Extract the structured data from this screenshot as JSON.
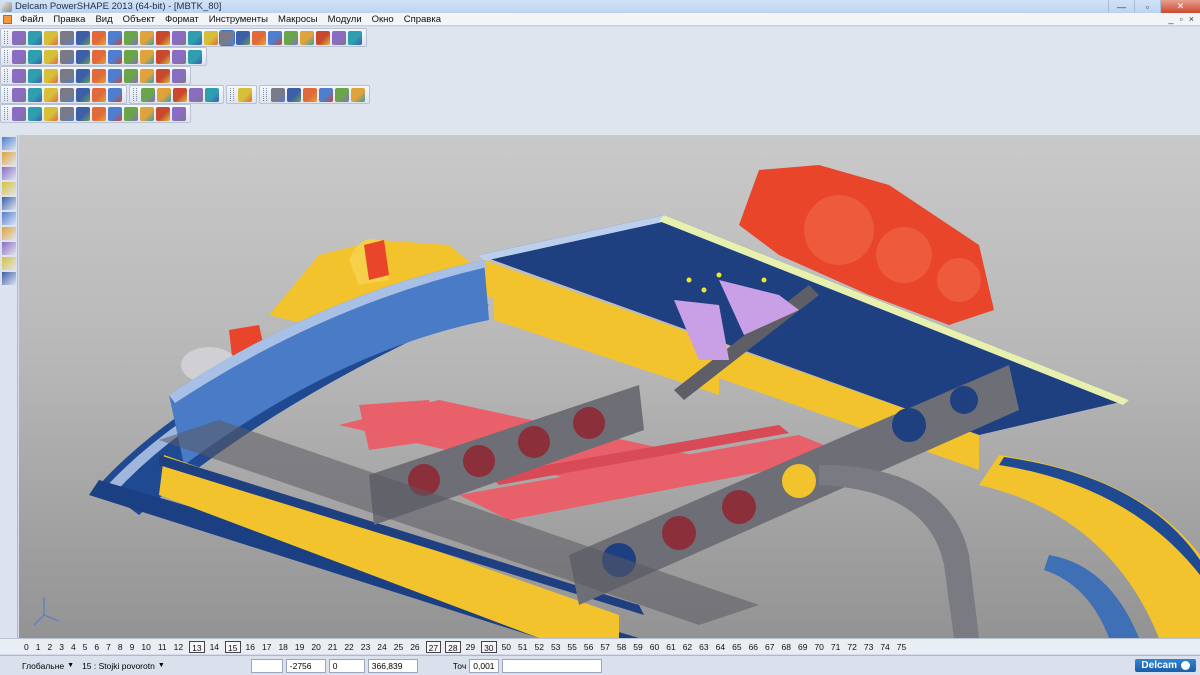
{
  "window": {
    "title": "Delcam PowerSHAPE 2013 (64-bit) - [MBTK_80]",
    "minimize": "—",
    "maximize": "▫",
    "close": "✕"
  },
  "menu": {
    "items": [
      "Файл",
      "Правка",
      "Вид",
      "Объект",
      "Формат",
      "Инструменты",
      "Макросы",
      "Модули",
      "Окно",
      "Справка"
    ],
    "mdi_minimize": "_",
    "mdi_restore": "▫",
    "mdi_close": "×"
  },
  "toolbars": {
    "row1_icons": [
      "new-model-icon",
      "open-icon",
      "save-icon",
      "save-as-icon",
      "print-icon",
      "cut-icon",
      "copy-icon",
      "paste-icon",
      "delete-icon",
      "undo-icon",
      "redo-icon",
      "snap-icon",
      "rotate-view-icon",
      "select-icon",
      "circle-icon",
      "spline-icon",
      "curve-icon",
      "surface-icon",
      "solid-icon",
      "lamp-icon",
      "sketch-icon",
      "hammer-icon"
    ],
    "row2_icons": [
      "view-box-icon",
      "view-iso-icon",
      "view-front-icon",
      "view-cube-icon",
      "view-flip-icon",
      "zoom-icon",
      "zoom-fit-icon",
      "globe-icon",
      "shade-icon",
      "wire-icon",
      "light-icon",
      "render-icon"
    ],
    "row3_icons": [
      "doc-icon",
      "sphere-icon",
      "cone-icon",
      "torus-icon",
      "cylinder-icon",
      "play-icon",
      "play2-icon",
      "block-icon",
      "cube-icon",
      "boolean-icon",
      "fillet-icon"
    ],
    "row4_icons": [
      "solid-a-icon",
      "solid-b-icon",
      "solid-c-icon",
      "solid-d-icon",
      "solid-e-icon",
      "solid-f-icon",
      "solid-g-icon",
      "feature-a-icon",
      "feature-b-icon",
      "feature-c-icon",
      "feature-d-icon",
      "feature-e-icon",
      "tree-a-icon",
      "tree-b-icon",
      "tree-c-icon",
      "tree-d-icon",
      "tree-e-icon",
      "tree-f-icon",
      "tree-g-icon"
    ],
    "row5_icons": [
      "surface-a-icon",
      "curve-x-icon",
      "surface-b-icon",
      "surface-c-icon",
      "surface-d-icon",
      "surface-e-icon",
      "surface-f-icon",
      "surface-g-icon",
      "surface-h-icon",
      "surface-i-icon",
      "surface-j-icon"
    ]
  },
  "left_tools": [
    "select-tool-icon",
    "selection-filter-icon",
    "line-tool-icon",
    "spline-tool-icon",
    "rectangle-tool-icon",
    "circle-tool-icon",
    "solid-tool-icon",
    "dimension-tool-icon",
    "arc-tool-icon",
    "angle-tool-icon"
  ],
  "levels": {
    "items": [
      "0",
      "1",
      "2",
      "3",
      "4",
      "5",
      "6",
      "7",
      "8",
      "9",
      "10",
      "11",
      "12",
      "13",
      "14",
      "15",
      "16",
      "17",
      "18",
      "19",
      "20",
      "21",
      "22",
      "23",
      "24",
      "25",
      "26",
      "27",
      "28",
      "29",
      "30",
      "50",
      "51",
      "52",
      "53",
      "55",
      "56",
      "57",
      "58",
      "59",
      "60",
      "61",
      "62",
      "63",
      "64",
      "65",
      "66",
      "67",
      "68",
      "69",
      "70",
      "71",
      "72",
      "73",
      "74",
      "75"
    ],
    "boxed": [
      "13",
      "15",
      "27",
      "28",
      "30"
    ]
  },
  "status": {
    "workplane": "Глобальне",
    "level": "15 : Stojki povorotn",
    "coord_x": "-2756",
    "coord_y": "0",
    "coord_z": "366,839",
    "tolerance_label": "Точ",
    "tolerance_value": "0,001",
    "brand": "Delcam"
  },
  "colors": {
    "frame_blue": "#1e3f80",
    "beam_yellow": "#f2c32c",
    "gear_red": "#e8452a",
    "rail_pink": "#e8606a",
    "steel_grey": "#6e6e76",
    "lavender": "#c9a0e6",
    "accent_blue": "#3b6fc8"
  }
}
